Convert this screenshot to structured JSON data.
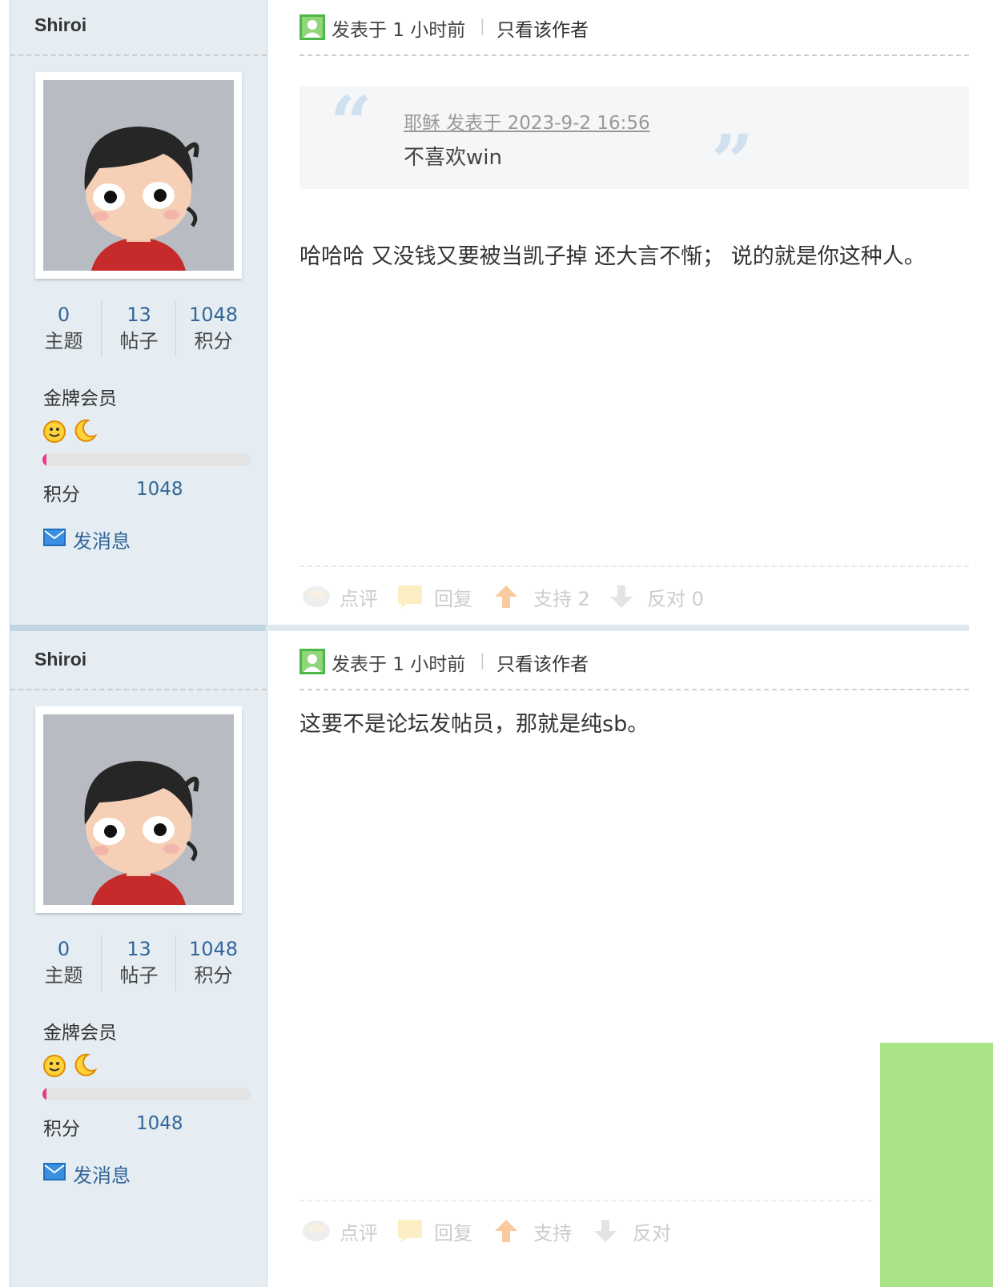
{
  "posts": [
    {
      "username": "Shiroi",
      "stats": [
        {
          "value": "0",
          "label": "主题"
        },
        {
          "value": "13",
          "label": "帖子"
        },
        {
          "value": "1048",
          "label": "积分"
        }
      ],
      "rank": "金牌会员",
      "rank_icons": [
        "smiley-icon",
        "moon-icon"
      ],
      "progress_fraction": 0.02,
      "credit_label": "积分",
      "credit_value": "1048",
      "send_message": "发消息",
      "posted_time": "发表于 1 小时前",
      "separator": "|",
      "author_only": "只看该作者",
      "quote": {
        "source": "耶稣 发表于 2023-9-2 16:56",
        "text": "不喜欢win",
        "open_mark": "“",
        "close_mark": "”"
      },
      "body": "哈哈哈 又没钱又要被当凯子掉 还大言不惭； 说的就是你这种人。",
      "actions": {
        "comment": "点评",
        "reply": "回复",
        "support": "支持 2",
        "oppose": "反对 0"
      }
    },
    {
      "username": "Shiroi",
      "stats": [
        {
          "value": "0",
          "label": "主题"
        },
        {
          "value": "13",
          "label": "帖子"
        },
        {
          "value": "1048",
          "label": "积分"
        }
      ],
      "rank": "金牌会员",
      "rank_icons": [
        "smiley-icon",
        "moon-icon"
      ],
      "progress_fraction": 0.02,
      "credit_label": "积分",
      "credit_value": "1048",
      "send_message": "发消息",
      "posted_time": "发表于 1 小时前",
      "separator": "|",
      "author_only": "只看该作者",
      "body": "这要不是论坛发帖员，那就是纯sb。",
      "actions": {
        "comment": "点评",
        "reply": "回复",
        "support": "支持",
        "oppose": "反对"
      }
    }
  ],
  "colors": {
    "sidebar_bg": "#e5edf2",
    "link_blue": "#336699",
    "progress_pink": "#e73a8a",
    "quote_bg": "#f5f6f7",
    "ad_green": "#a9e487"
  }
}
